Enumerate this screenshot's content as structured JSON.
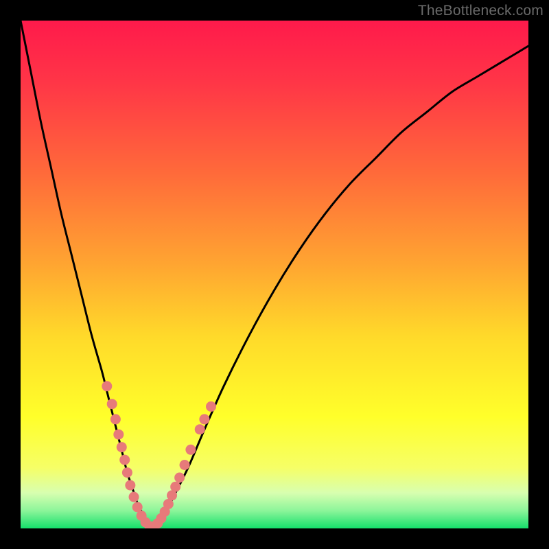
{
  "watermark": "TheBottleneck.com",
  "colors": {
    "frame": "#000000",
    "curve_stroke": "#000000",
    "dot_fill": "#e77a7a",
    "gradient_stops": [
      {
        "offset": 0.0,
        "color": "#ff1a4b"
      },
      {
        "offset": 0.12,
        "color": "#ff3547"
      },
      {
        "offset": 0.3,
        "color": "#ff6a3a"
      },
      {
        "offset": 0.48,
        "color": "#ffa531"
      },
      {
        "offset": 0.62,
        "color": "#ffd92a"
      },
      {
        "offset": 0.78,
        "color": "#ffff2a"
      },
      {
        "offset": 0.88,
        "color": "#f6ff66"
      },
      {
        "offset": 0.93,
        "color": "#d8ffb0"
      },
      {
        "offset": 0.965,
        "color": "#8cf59a"
      },
      {
        "offset": 1.0,
        "color": "#15e06b"
      }
    ]
  },
  "chart_data": {
    "type": "line",
    "title": "",
    "xlabel": "",
    "ylabel": "",
    "xlim": [
      0,
      100
    ],
    "ylim": [
      0,
      100
    ],
    "series": [
      {
        "name": "bottleneck-curve",
        "x": [
          0,
          2,
          4,
          6,
          8,
          10,
          12,
          14,
          16,
          17,
          18,
          19,
          20,
          21,
          22,
          23,
          24,
          25,
          26,
          28,
          30,
          33,
          36,
          40,
          45,
          50,
          55,
          60,
          65,
          70,
          75,
          80,
          85,
          90,
          95,
          100
        ],
        "y": [
          100,
          90,
          80,
          71,
          62,
          54,
          46,
          38,
          31,
          27,
          23,
          19,
          15,
          11,
          8,
          5,
          3,
          1,
          0,
          2,
          6,
          12,
          19,
          28,
          38,
          47,
          55,
          62,
          68,
          73,
          78,
          82,
          86,
          89,
          92,
          95
        ]
      }
    ],
    "dots": {
      "name": "highlighted-points",
      "points": [
        {
          "x": 17.0,
          "y": 28.0
        },
        {
          "x": 18.0,
          "y": 24.5
        },
        {
          "x": 18.7,
          "y": 21.5
        },
        {
          "x": 19.3,
          "y": 18.5
        },
        {
          "x": 19.9,
          "y": 16.0
        },
        {
          "x": 20.5,
          "y": 13.5
        },
        {
          "x": 21.0,
          "y": 11.0
        },
        {
          "x": 21.6,
          "y": 8.5
        },
        {
          "x": 22.3,
          "y": 6.2
        },
        {
          "x": 23.0,
          "y": 4.2
        },
        {
          "x": 23.8,
          "y": 2.5
        },
        {
          "x": 24.6,
          "y": 1.2
        },
        {
          "x": 25.4,
          "y": 0.4
        },
        {
          "x": 26.2,
          "y": 0.4
        },
        {
          "x": 27.0,
          "y": 1.0
        },
        {
          "x": 27.7,
          "y": 2.0
        },
        {
          "x": 28.4,
          "y": 3.3
        },
        {
          "x": 29.1,
          "y": 4.8
        },
        {
          "x": 29.8,
          "y": 6.5
        },
        {
          "x": 30.5,
          "y": 8.2
        },
        {
          "x": 31.3,
          "y": 10.0
        },
        {
          "x": 32.3,
          "y": 12.5
        },
        {
          "x": 33.5,
          "y": 15.5
        },
        {
          "x": 35.3,
          "y": 19.5
        },
        {
          "x": 36.2,
          "y": 21.5
        },
        {
          "x": 37.5,
          "y": 24.0
        }
      ]
    }
  }
}
